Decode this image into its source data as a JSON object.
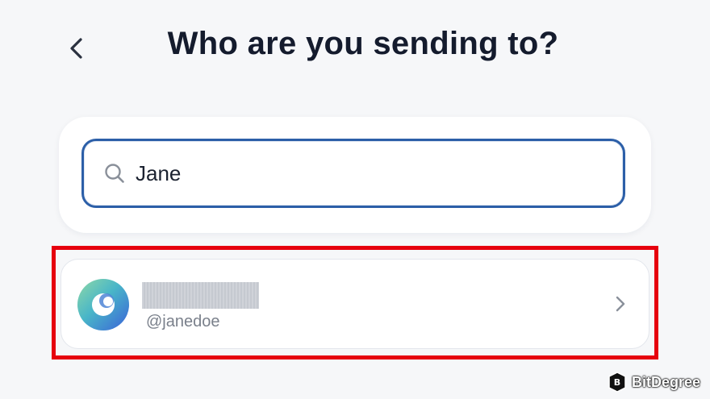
{
  "header": {
    "title": "Who are you sending to?",
    "back_icon": "chevron-left-icon"
  },
  "search": {
    "value": "Jane",
    "icon": "search-icon",
    "accent_color": "#2c5fa8"
  },
  "results": [
    {
      "handle": "@janedoe",
      "name_redacted": true,
      "avatar_icon": "crescent-moon-avatar",
      "chevron_icon": "chevron-right-icon"
    }
  ],
  "highlight_color": "#e6000e",
  "watermark": {
    "text": "BitDegree"
  }
}
